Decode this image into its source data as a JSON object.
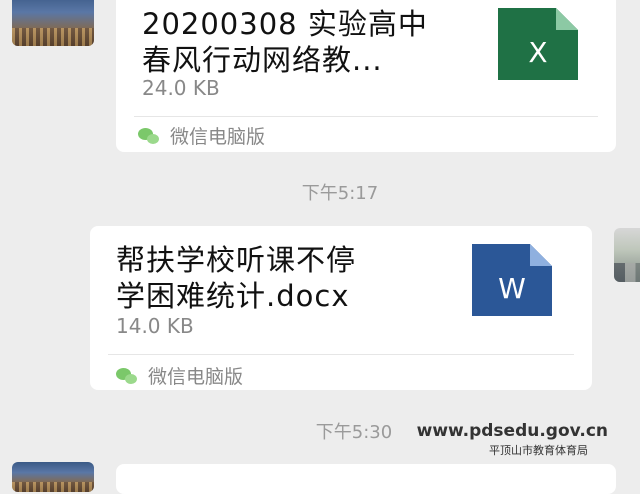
{
  "messages": [
    {
      "file_name_line1": "20200308 实验高中",
      "file_name_line2": "春风行动网络教...",
      "file_size": "24.0 KB",
      "file_type_icon": "excel-file-icon",
      "file_icon_letter": "X",
      "source": "微信电脑版"
    },
    {
      "file_name_line1": "帮扶学校听课不停",
      "file_name_line2": "学困难统计.docx",
      "file_size": "14.0 KB",
      "file_type_icon": "word-file-icon",
      "file_icon_letter": "W",
      "source": "微信电脑版"
    }
  ],
  "timestamps": [
    "下午5:17",
    "下午5:30"
  ],
  "watermark": {
    "url": "www.pdsedu.gov.cn",
    "org": "平顶山市教育体育局"
  },
  "colors": {
    "excel": "#1f7145",
    "word": "#2b5797",
    "background": "#ededed"
  }
}
